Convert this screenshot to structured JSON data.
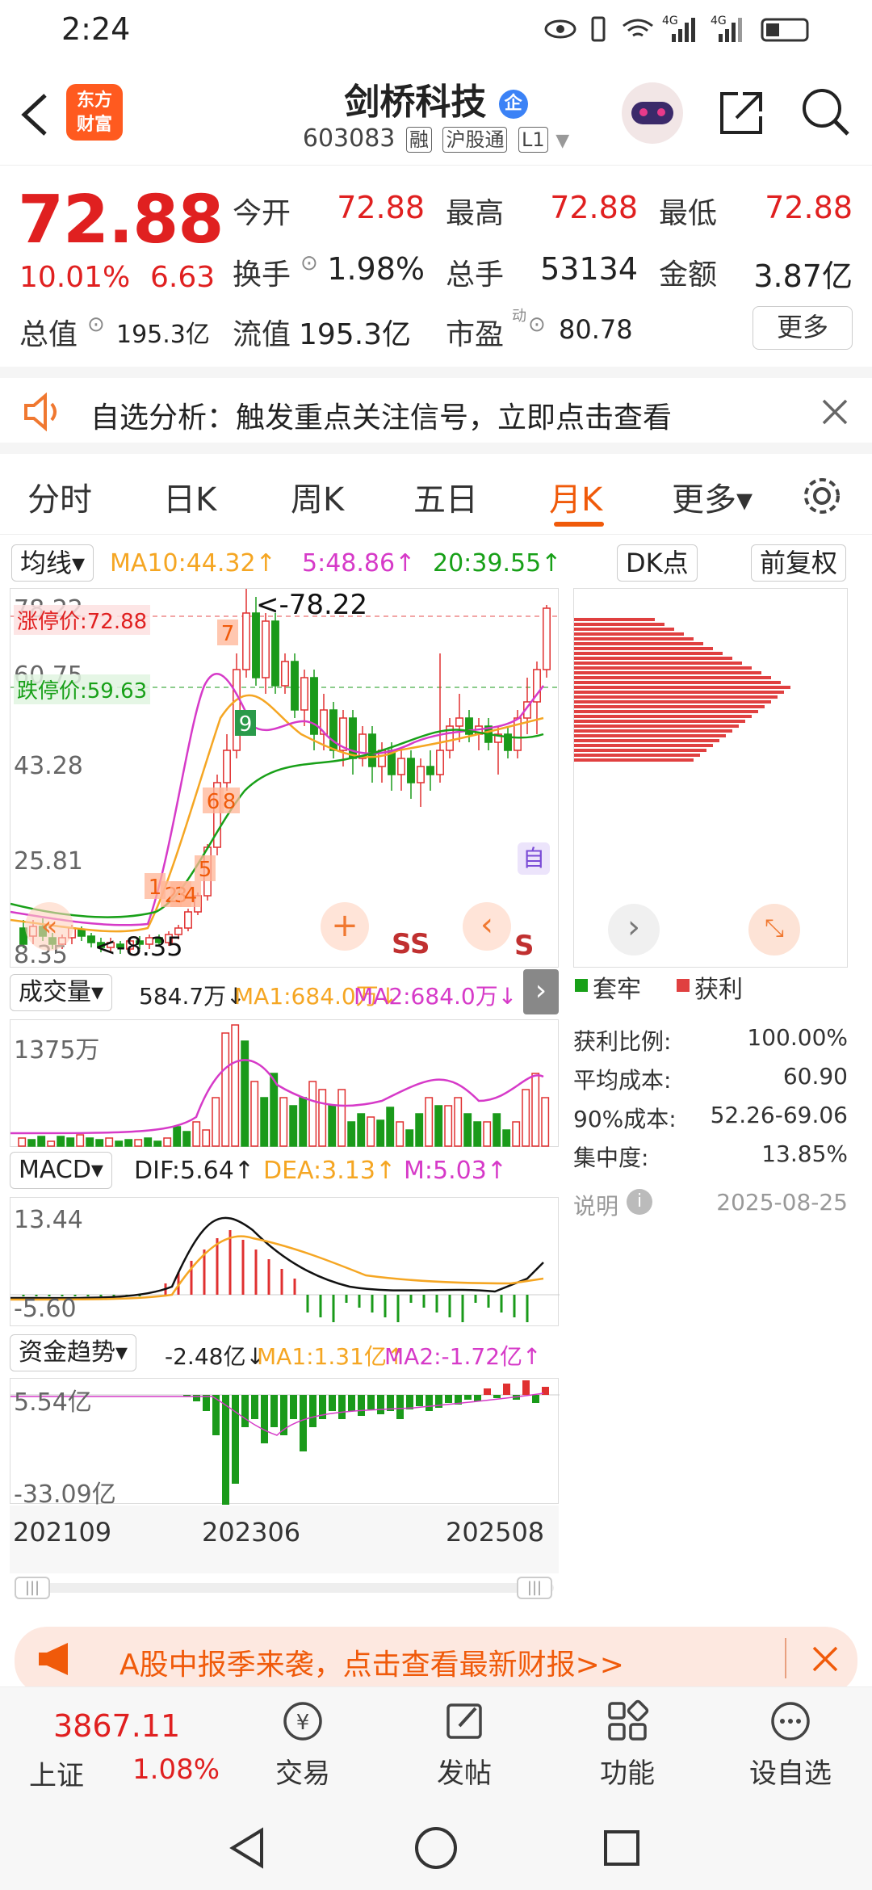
{
  "status": {
    "time": "2:24",
    "signal1": "4G",
    "signal2": "4G"
  },
  "header": {
    "logo_line1": "东方",
    "logo_line2": "财富",
    "title": "剑桥科技",
    "badge": "企",
    "code": "603083",
    "tags": [
      "融",
      "沪股通",
      "L1"
    ]
  },
  "quote": {
    "price": "72.88",
    "change_pct": "10.01%",
    "change_amt": "6.63",
    "open_label": "今开",
    "open": "72.88",
    "high_label": "最高",
    "high": "72.88",
    "low_label": "最低",
    "low": "72.88",
    "turnover_label": "换手",
    "turnover": "1.98%",
    "volume_label": "总手",
    "volume": "53134",
    "amount_label": "金额",
    "amount": "3.87亿",
    "mktcap_label": "总值",
    "mktcap": "195.3亿",
    "float_label": "流值",
    "float": "195.3亿",
    "pe_label": "市盈",
    "pe_sup": "动",
    "pe": "80.78",
    "more": "更多"
  },
  "notice": {
    "text": "自选分析：触发重点关注信号，立即点击查看"
  },
  "tabs": [
    "分时",
    "日K",
    "周K",
    "五日",
    "月K",
    "更多▾"
  ],
  "active_tab": "月K",
  "kline": {
    "ma_selector": "均线▾",
    "ma10": "MA10:44.32↑",
    "ma5": "5:48.86↑",
    "ma20": "20:39.55↑",
    "dk": "DK点",
    "fuquan": "前复权",
    "y_labels": [
      "78.22",
      "60.75",
      "43.28",
      "25.81",
      "8.35"
    ],
    "limit_up": "涨停价:72.88",
    "limit_down": "跌停价:59.63",
    "high_marker": "<-78.22",
    "low_marker": "<-8.35",
    "signals": [
      "1",
      "2",
      "3",
      "4",
      "5",
      "6",
      "8",
      "7",
      "9"
    ],
    "ss": "SS",
    "s": "S",
    "zi": "自"
  },
  "volume": {
    "selector": "成交量▾",
    "val": "584.7万↓",
    "ma1": "MA1:684.0万↓",
    "ma2": "MA2:684.0万↓",
    "ylabel": "1375万"
  },
  "macd": {
    "selector": "MACD▾",
    "dif": "DIF:5.64↑",
    "dea": "DEA:3.13↑",
    "m": "M:5.03↑",
    "ytop": "13.44",
    "ybot": "-5.60"
  },
  "fund": {
    "selector": "资金趋势▾",
    "val": "-2.48亿↓",
    "ma1": "MA1:1.31亿↑",
    "ma2": "MA2:-1.72亿↑",
    "ytop": "5.54亿",
    "ybot": "-33.09亿"
  },
  "xaxis": [
    "202109",
    "202306",
    "202508"
  ],
  "chip": {
    "legend_trap": "套牢",
    "legend_profit": "获利",
    "rows": [
      {
        "label": "获利比例:",
        "value": "100.00%"
      },
      {
        "label": "平均成本:",
        "value": "60.90"
      },
      {
        "label": "90%成本:",
        "value": "52.26-69.06"
      },
      {
        "label": "集中度:",
        "value": "13.85%"
      }
    ],
    "note": "说明",
    "date": "2025-08-25"
  },
  "banner": {
    "text": "A股中报季来袭，点击查看最新财报>>"
  },
  "bottom": {
    "index_value": "3867.11",
    "index_name": "上证",
    "index_change": "1.08%",
    "items": [
      "交易",
      "发帖",
      "功能",
      "设自选"
    ]
  },
  "colors": {
    "red": "#e02020",
    "green": "#18a018",
    "orange": "#f5a623",
    "magenta": "#d63ac8"
  }
}
